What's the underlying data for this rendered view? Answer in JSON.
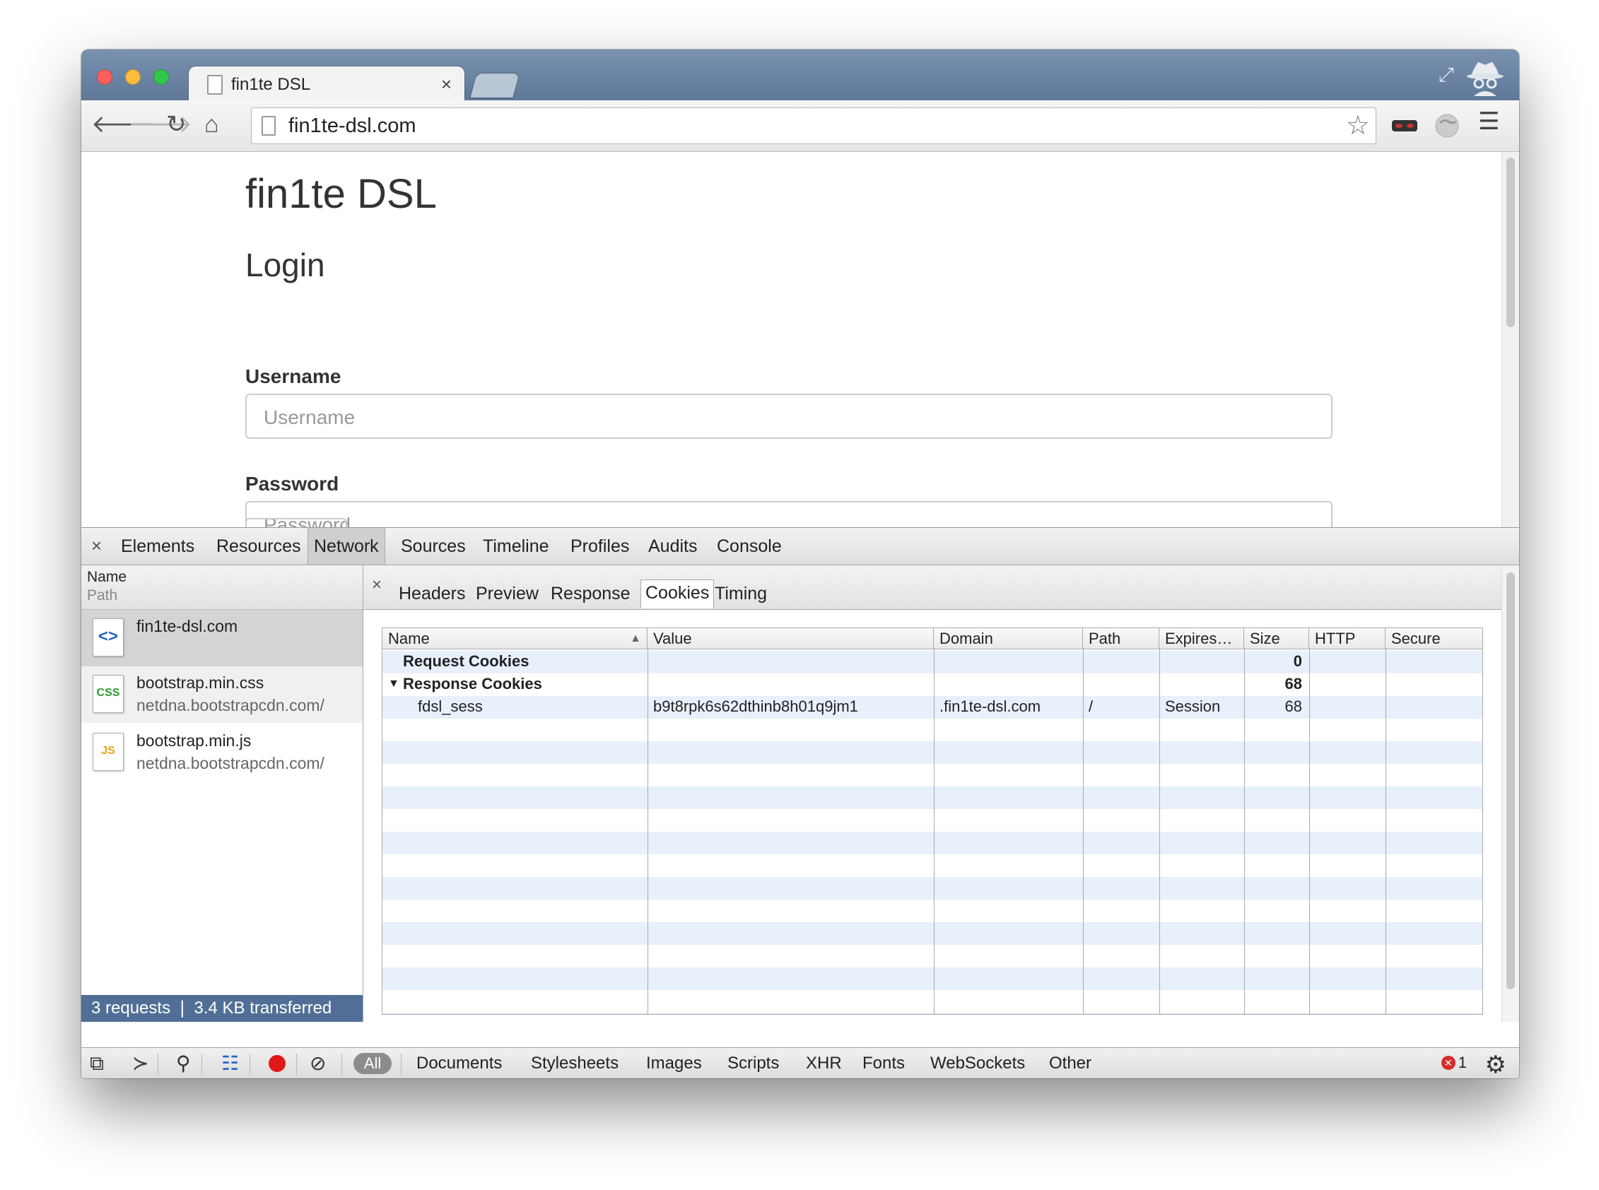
{
  "browser": {
    "tab_title": "fin1te DSL",
    "tab_close": "×",
    "url": "fin1te-dsl.com"
  },
  "page": {
    "site_title": "fin1te DSL",
    "heading": "Login",
    "username_label": "Username",
    "username_placeholder": "Username",
    "password_label": "Password",
    "password_placeholder": "Password"
  },
  "devtools": {
    "close": "×",
    "tabs": [
      "Elements",
      "Resources",
      "Network",
      "Sources",
      "Timeline",
      "Profiles",
      "Audits",
      "Console"
    ],
    "active_tab": "Network",
    "request_list": {
      "header_name": "Name",
      "header_path": "Path",
      "items": [
        {
          "name": "fin1te-dsl.com",
          "path": "",
          "type": "html",
          "icon_text": "<>"
        },
        {
          "name": "bootstrap.min.css",
          "path": "netdna.bootstrapcdn.com/",
          "type": "css",
          "icon_text": "CSS"
        },
        {
          "name": "bootstrap.min.js",
          "path": "netdna.bootstrapcdn.com/",
          "type": "js",
          "icon_text": "JS"
        }
      ],
      "summary": "3 requests  ❘  3.4 KB transferred"
    },
    "detail_tabs": [
      "Headers",
      "Preview",
      "Response",
      "Cookies",
      "Timing"
    ],
    "active_detail_tab": "Cookies",
    "cookie_columns": [
      "Name",
      "Value",
      "Domain",
      "Path",
      "Expires…",
      "Size",
      "HTTP",
      "Secure"
    ],
    "sort_indicator": "▲",
    "cookie_rows": {
      "request_group": "Request Cookies",
      "request_size": "0",
      "response_group": "Response Cookies",
      "response_size": "68",
      "cookie": {
        "name": "fdsl_sess",
        "value": "b9t8rpk6s62dthinb8h01q9jm1",
        "domain": ".fin1te-dsl.com",
        "path": "/",
        "expires": "Session",
        "size": "68"
      }
    },
    "filters": [
      "All",
      "Documents",
      "Stylesheets",
      "Images",
      "Scripts",
      "XHR",
      "Fonts",
      "WebSockets",
      "Other"
    ],
    "error_count": "1"
  }
}
